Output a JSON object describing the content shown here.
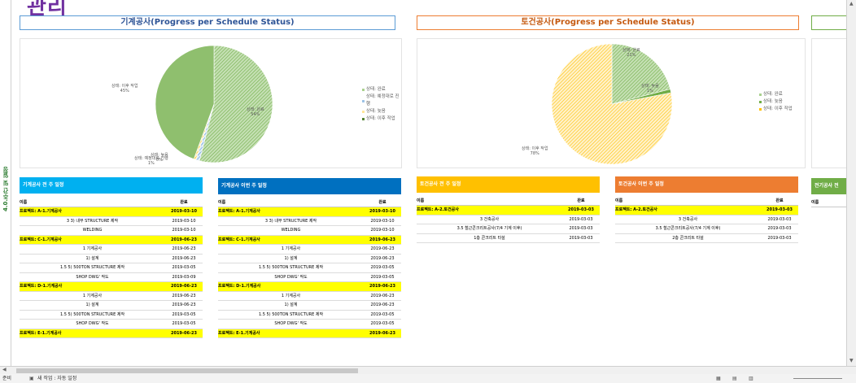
{
  "page_title": "관리",
  "side_tab": "4.0.주간 및 일정",
  "mech_chart": {
    "banner": "기계공사(Progress per Schedule Status)",
    "labels": [
      {
        "name": "상태: 이후 작업",
        "pct": "45%"
      },
      {
        "name": "상태: 완료",
        "pct": "54%"
      },
      {
        "name": "상태: 예정대로 진행",
        "pct": "1%"
      },
      {
        "name": "상태: 늦음",
        "pct": "0%"
      }
    ],
    "legend": [
      "상태: 완료",
      "상태: 예정대로 진행",
      "상태: 늦음",
      "상태: 이후 작업"
    ]
  },
  "civil_chart": {
    "banner": "토건공사(Progress per Schedule Status)",
    "labels": [
      {
        "name": "상태: 완료",
        "pct": "21%"
      },
      {
        "name": "상태: 늦음",
        "pct": "1%"
      },
      {
        "name": "상태: 이후 작업",
        "pct": "78%"
      }
    ],
    "legend": [
      "상태: 완료",
      "상태: 늦음",
      "상태: 이후 작업"
    ]
  },
  "chart_colors": {
    "done": "#a9d18e",
    "ontrack": "#9dc3e6",
    "late": "#ffe699",
    "after": "#a9d18e",
    "after_civil": "#ffe699"
  },
  "tables": {
    "mech_all": {
      "header": "기계공사 전 주 일정",
      "color": "#00b0f0",
      "col1": "이름",
      "col2": "완료",
      "rows": [
        {
          "p": true,
          "n": "프로젝트: A-1.기계공사",
          "d": "2019-03-10"
        },
        {
          "p": false,
          "n": "3   3) 내부 STRUCTURE 제작",
          "d": "2019-03-10"
        },
        {
          "p": false,
          "n": "WELDING",
          "d": "2019-03-10"
        },
        {
          "p": true,
          "n": "프로젝트: C-1.기계공사",
          "d": "2019-06-23"
        },
        {
          "p": false,
          "n": "1  기계공사",
          "d": "2019-06-23"
        },
        {
          "p": false,
          "n": "1) 설계",
          "d": "2019-06-23"
        },
        {
          "p": false,
          "n": "1.5   5) 500TON STRUCTURE 제작",
          "d": "2019-03-05"
        },
        {
          "p": false,
          "n": "SHOP DWG' 작도",
          "d": "2019-03-09"
        },
        {
          "p": true,
          "n": "프로젝트: D-1.기계공사",
          "d": "2019-06-23"
        },
        {
          "p": false,
          "n": "1  기계공사",
          "d": "2019-06-23"
        },
        {
          "p": false,
          "n": "1) 설계",
          "d": "2019-06-23"
        },
        {
          "p": false,
          "n": "1.5   5) 500TON STRUCTURE 제작",
          "d": "2019-03-05"
        },
        {
          "p": false,
          "n": "SHOP DWG' 작도",
          "d": "2019-03-05"
        },
        {
          "p": true,
          "n": "프로젝트: E-1.기계공사",
          "d": "2019-06-23"
        }
      ]
    },
    "mech_this": {
      "header": "기계공사 이번 주 일정",
      "color": "#0070c0",
      "col1": "이름",
      "col2": "완료",
      "rows": [
        {
          "p": true,
          "n": "프로젝트: A-1.기계공사",
          "d": "2019-03-10"
        },
        {
          "p": false,
          "n": "3   3) 내부 STRUCTURE 제작",
          "d": "2019-03-10"
        },
        {
          "p": false,
          "n": "WELDING",
          "d": "2019-03-10"
        },
        {
          "p": true,
          "n": "프로젝트: C-1.기계공사",
          "d": "2019-06-23"
        },
        {
          "p": false,
          "n": "1  기계공사",
          "d": "2019-06-23"
        },
        {
          "p": false,
          "n": "1) 설계",
          "d": "2019-06-23"
        },
        {
          "p": false,
          "n": "1.5   5) 500TON STRUCTURE 제작",
          "d": "2019-03-05"
        },
        {
          "p": false,
          "n": "SHOP DWG' 작도",
          "d": "2019-03-05"
        },
        {
          "p": true,
          "n": "프로젝트: D-1.기계공사",
          "d": "2019-06-23"
        },
        {
          "p": false,
          "n": "1  기계공사",
          "d": "2019-06-23"
        },
        {
          "p": false,
          "n": "1) 설계",
          "d": "2019-06-23"
        },
        {
          "p": false,
          "n": "1.5   5) 500TON STRUCTURE 제작",
          "d": "2019-03-05"
        },
        {
          "p": false,
          "n": "SHOP DWG' 작도",
          "d": "2019-03-05"
        },
        {
          "p": true,
          "n": "프로젝트: E-1.기계공사",
          "d": "2019-06-23"
        }
      ]
    },
    "civil_all": {
      "header": "토건공사 전 주 일정",
      "color": "#ffc000",
      "col1": "이름",
      "col2": "완료",
      "rows": [
        {
          "p": true,
          "n": "프로젝트: A-2.토건공사",
          "d": "2019-03-03"
        },
        {
          "p": false,
          "n": "3  건축공사",
          "d": "2019-03-03"
        },
        {
          "p": false,
          "n": "3.5  철근콘크리트공사(7/4 기계 이후)",
          "d": "2019-03-03"
        },
        {
          "p": false,
          "n": "1층 콘크리트 타설",
          "d": "2019-03-03"
        }
      ]
    },
    "civil_this": {
      "header": "토건공사 이번 주 일정",
      "color": "#ed7d31",
      "col1": "이름",
      "col2": "완료",
      "rows": [
        {
          "p": true,
          "n": "프로젝트: A-2.토건공사",
          "d": "2019-03-03"
        },
        {
          "p": false,
          "n": "3  건축공사",
          "d": "2019-03-03"
        },
        {
          "p": false,
          "n": "3.5  철근콘크리트공사(7/4 기계 이후)",
          "d": "2019-03-03"
        },
        {
          "p": false,
          "n": "2층 콘크리트 타설",
          "d": "2019-03-03"
        }
      ]
    },
    "elec_all": {
      "header": "전기공사 전",
      "color": "#70ad47",
      "col1": "이름",
      "col2": "",
      "rows": []
    }
  },
  "status_bar": {
    "ready": "준비",
    "macro": "새 작업 : 자동 일정"
  }
}
